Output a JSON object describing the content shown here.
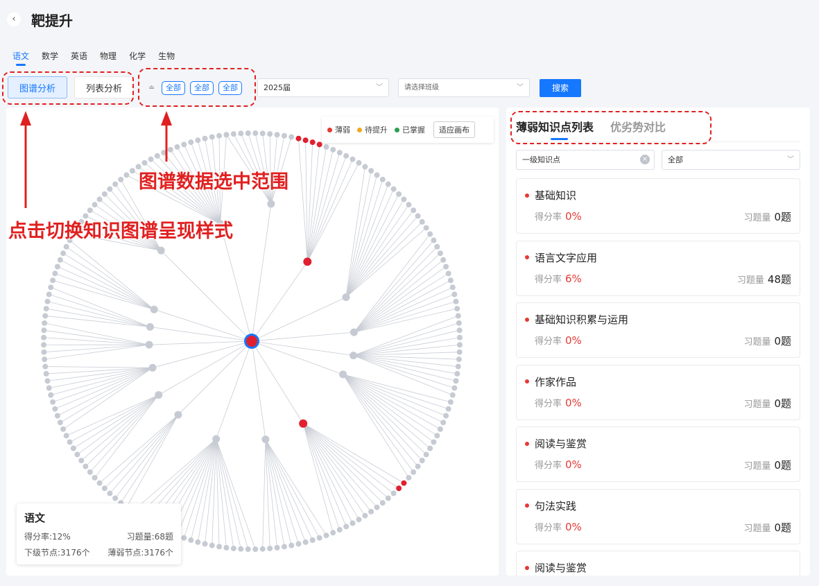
{
  "header": {
    "back_icon": "‹",
    "title": "靶提升"
  },
  "subjects": [
    "语文",
    "数学",
    "英语",
    "物理",
    "化学",
    "生物"
  ],
  "active_subject": 0,
  "toolbar": {
    "graph_view_label": "图谱分析",
    "list_view_label": "列表分析",
    "filter_icon": "≐",
    "filter_chips": [
      "全部",
      "全部",
      "全部"
    ],
    "grade_select": "2025届",
    "class_select_placeholder": "请选择班级",
    "search_label": "搜索"
  },
  "legend": {
    "items": [
      {
        "label": "薄弱",
        "color": "#e53935"
      },
      {
        "label": "待提升",
        "color": "#f5a623"
      },
      {
        "label": "已掌握",
        "color": "#2e9e4f"
      }
    ],
    "fit_label": "适应画布"
  },
  "graph": {
    "root_color": "#e02030",
    "root_ring_color": "#1677ff",
    "node_color": "#c6cad2",
    "weak_color": "#e02030",
    "link_color": "#c8ccd4"
  },
  "summary": {
    "title": "语文",
    "score_label": "得分率:12%",
    "count_label": "习题量:68题",
    "child_label": "下级节点:3176个",
    "weak_label": "薄弱节点:3176个"
  },
  "right_panel": {
    "tabs": [
      "薄弱知识点列表",
      "优劣势对比"
    ],
    "level_input": "一级知识点",
    "level_select": "全部",
    "score_label": "得分率",
    "count_label": "习题量",
    "cards": [
      {
        "title": "基础知识",
        "score": "0%",
        "count": "0题"
      },
      {
        "title": "语言文字应用",
        "score": "6%",
        "count": "48题"
      },
      {
        "title": "基础知识积累与运用",
        "score": "0%",
        "count": "0题"
      },
      {
        "title": "作家作品",
        "score": "0%",
        "count": "0题"
      },
      {
        "title": "阅读与鉴赏",
        "score": "0%",
        "count": "0题"
      },
      {
        "title": "句法实践",
        "score": "0%",
        "count": "0题"
      },
      {
        "title": "阅读与鉴赏",
        "score": "",
        "count": ""
      }
    ]
  },
  "annotations": {
    "range_text": "图谱数据选中范围",
    "switch_text": "点击切换知识图谱呈现样式",
    "color": "#e02020"
  }
}
